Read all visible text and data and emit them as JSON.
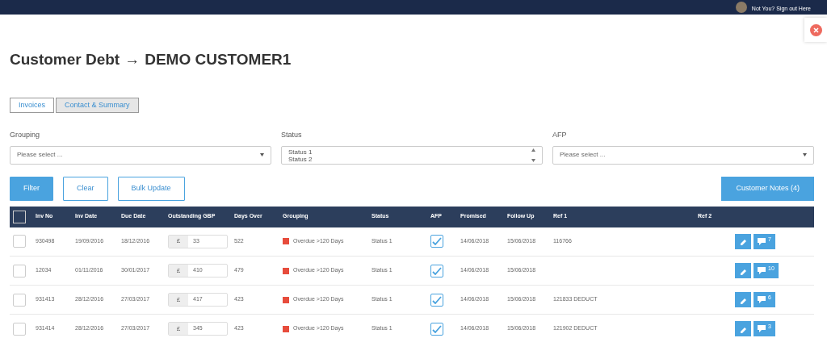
{
  "header": {
    "user_link": "Not You? Sign out Here"
  },
  "title": {
    "main": "Customer Debt",
    "arrow": "→",
    "customer": "DEMO CUSTOMER1"
  },
  "tabs": [
    {
      "label": "Invoices",
      "selected": true
    },
    {
      "label": "Contact & Summary",
      "selected": false
    }
  ],
  "filters": [
    {
      "label": "Grouping",
      "kind": "select",
      "placeholder": "Please select ..."
    },
    {
      "label": "Status",
      "kind": "list",
      "options": [
        "Status 1",
        "Status 2"
      ]
    },
    {
      "label": "AFP",
      "kind": "select",
      "placeholder": "Please select ..."
    }
  ],
  "buttons": [
    {
      "label": "Filter",
      "kind": "primary"
    },
    {
      "label": "Clear",
      "kind": "outline"
    },
    {
      "label": "Bulk Update",
      "kind": "outline"
    }
  ],
  "notes_button": "Customer Notes (4)",
  "table": {
    "select_all": {
      "checked": false
    },
    "columns": [
      "Inv No",
      "Inv Date",
      "Due Date",
      "Outstanding GBP",
      "Days Over",
      "Grouping",
      "Status",
      "AFP",
      "Promised",
      "Follow Up",
      "Ref 1",
      "Ref 2"
    ],
    "rows": [
      {
        "selected": false,
        "inv_no": "930498",
        "inv_date": "19/09/2016",
        "due_date": "18/12/2016",
        "currency": "£",
        "outstanding": "33",
        "days_over": "522",
        "grouping": "Overdue >120 Days",
        "color": "#e74c3c",
        "status": "Status 1",
        "afp": true,
        "promised": "14/06/2018",
        "follow_up": "15/06/2018",
        "ref1": "116766",
        "notes": "7"
      },
      {
        "selected": false,
        "inv_no": "12034",
        "inv_date": "01/11/2016",
        "due_date": "30/01/2017",
        "currency": "£",
        "outstanding": "410",
        "days_over": "479",
        "grouping": "Overdue >120 Days",
        "color": "#e74c3c",
        "status": "Status 1",
        "afp": true,
        "promised": "14/06/2018",
        "follow_up": "15/06/2018",
        "notes": "10"
      },
      {
        "selected": false,
        "inv_no": "931413",
        "inv_date": "28/12/2016",
        "due_date": "27/03/2017",
        "currency": "£",
        "outstanding": "417",
        "days_over": "423",
        "grouping": "Overdue >120 Days",
        "color": "#e74c3c",
        "status": "Status 1",
        "afp": true,
        "promised": "14/06/2018",
        "follow_up": "15/06/2018",
        "ref1": "121833 DEDUCT",
        "notes": "6"
      },
      {
        "selected": false,
        "inv_no": "931414",
        "inv_date": "28/12/2016",
        "due_date": "27/03/2017",
        "currency": "£",
        "outstanding": "345",
        "days_over": "423",
        "grouping": "Overdue >120 Days",
        "color": "#e74c3c",
        "status": "Status 1",
        "afp": true,
        "promised": "14/06/2018",
        "follow_up": "15/06/2018",
        "ref1": "121902 DEDUCT",
        "notes": "3"
      }
    ]
  }
}
